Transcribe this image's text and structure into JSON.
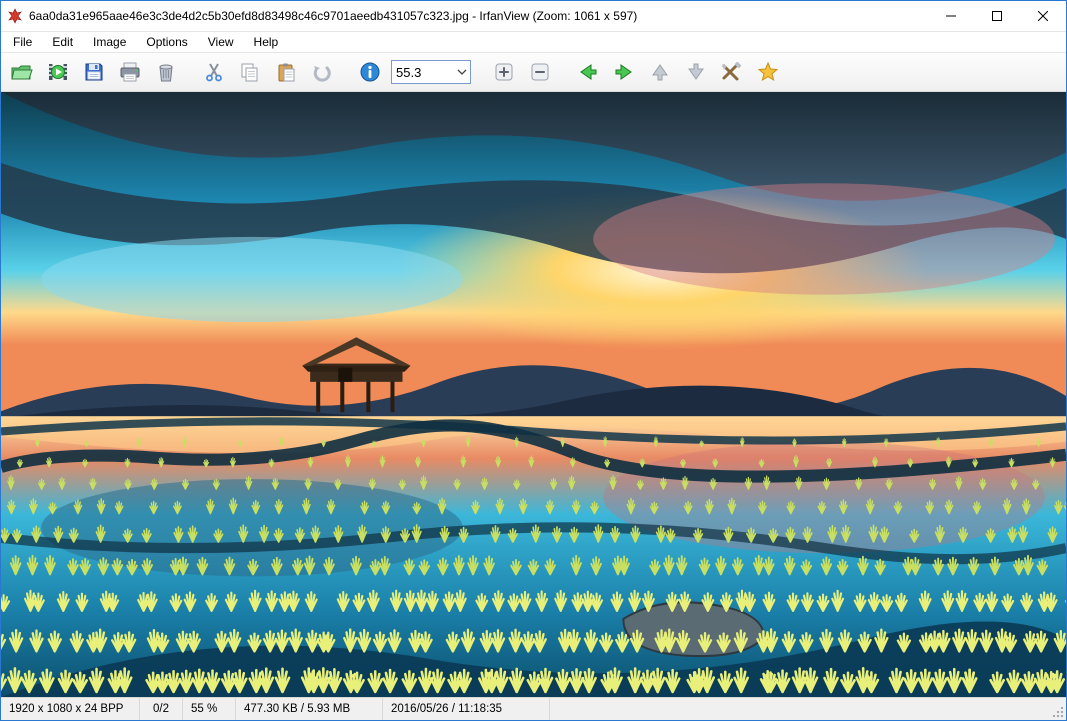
{
  "titlebar": {
    "title": "6aa0da31e965aae46e3c3de4d2c5b30efd8d83498c46c9701aeedb431057c323.jpg - IrfanView (Zoom: 1061 x 597)"
  },
  "menu": {
    "items": [
      "File",
      "Edit",
      "Image",
      "Options",
      "View",
      "Help"
    ]
  },
  "toolbar": {
    "zoom_value": "55.3"
  },
  "statusbar": {
    "dims": "1920 x 1080 x 24 BPP",
    "index": "0/2",
    "zoom": "55 %",
    "size": "477.30 KB / 5.93 MB",
    "datetime": "2016/05/26 / 11:18:35"
  }
}
